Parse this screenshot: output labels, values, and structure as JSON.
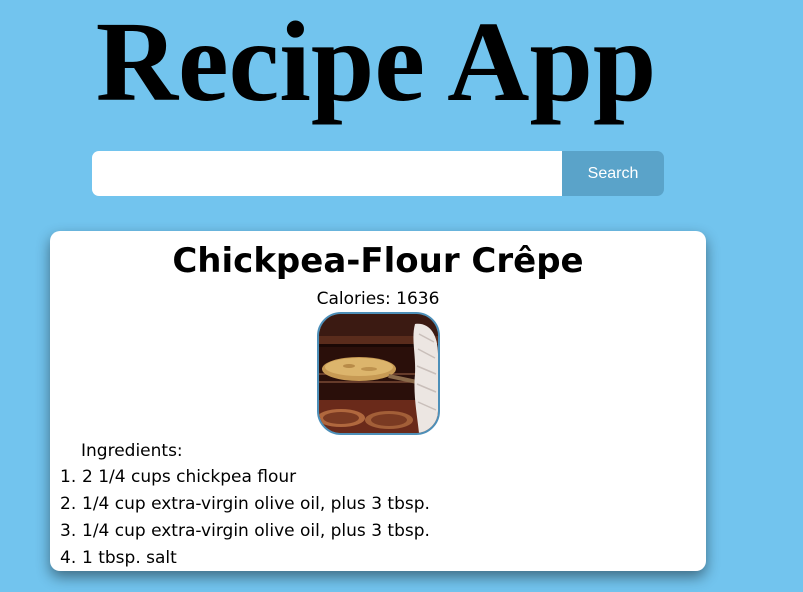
{
  "app": {
    "title": "Recipe App"
  },
  "search": {
    "value": "",
    "placeholder": "",
    "button_label": "Search"
  },
  "recipe": {
    "title": "Chickpea-Flour Crêpe",
    "calories_text": "Calories: 1636",
    "image_alt": "",
    "ingredients_label": "Ingredients:",
    "ingredients": [
      {
        "number": "1.",
        "text": "2 1/4 cups chickpea flour"
      },
      {
        "number": "2.",
        "text": "1/4 cup extra-virgin olive oil, plus 3 tbsp."
      },
      {
        "number": "3.",
        "text": "1/4 cup extra-virgin olive oil, plus 3 tbsp."
      },
      {
        "number": "4.",
        "text": "1 tbsp. salt"
      }
    ]
  },
  "colors": {
    "page_background": "#72c4ee",
    "search_button": "#5aa3c9",
    "image_border": "#4d8fb8",
    "card_background": "#ffffff"
  }
}
